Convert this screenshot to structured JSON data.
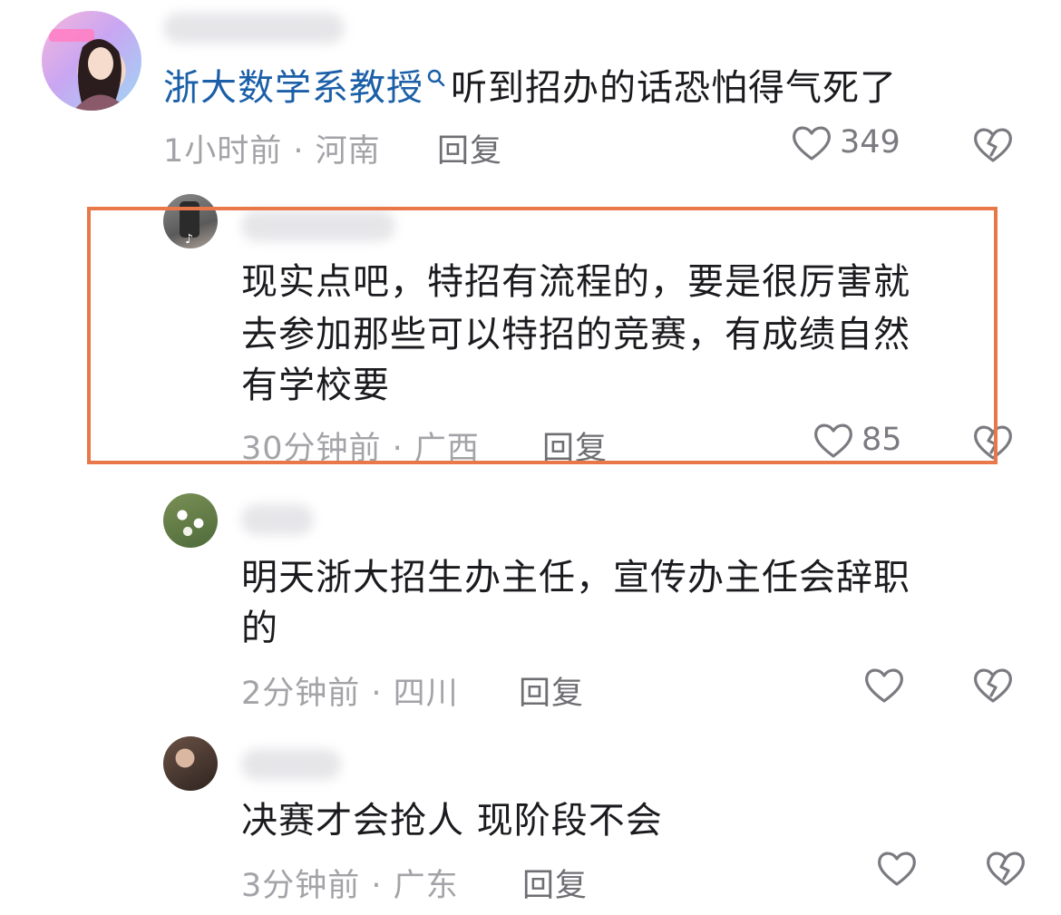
{
  "comments": [
    {
      "text_link": "浙大数学系教授",
      "text": "听到招办的话恐怕得气死了",
      "time_location": "1小时前 · 河南",
      "reply_label": "回复",
      "like_count": "349"
    },
    {
      "text_lines": [
        "现实点吧，特招有流程的，要是很厉害就",
        "去参加那些可以特招的竞赛，有成绩自然",
        "有学校要"
      ],
      "time_location": "30分钟前 · 广西",
      "reply_label": "回复",
      "like_count": "85"
    },
    {
      "text_lines": [
        "明天浙大招生办主任，宣传办主任会辞职",
        "的"
      ],
      "time_location": "2分钟前 · 四川",
      "reply_label": "回复",
      "like_count": ""
    },
    {
      "text_lines": [
        "决赛才会抢人 现阶段不会"
      ],
      "time_location": "3分钟前 · 广东",
      "reply_label": "回复",
      "like_count": ""
    }
  ],
  "colors": {
    "highlight_border": "#e8784a",
    "link": "#1b5fa8",
    "meta": "#a3a3a8"
  },
  "icons": [
    "heart-icon",
    "broken-heart-icon",
    "search-icon"
  ]
}
